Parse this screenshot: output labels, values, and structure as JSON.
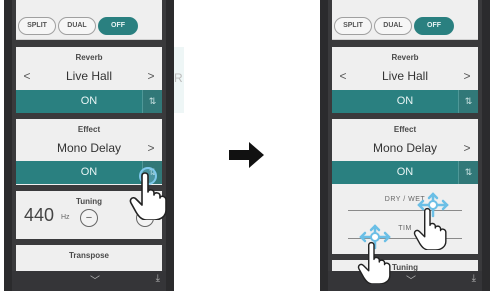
{
  "mode_buttons": [
    "SPLIT",
    "DUAL",
    "OFF"
  ],
  "reverb": {
    "title": "Reverb",
    "value": "Live Hall",
    "state": "ON"
  },
  "effect": {
    "title": "Effect",
    "value": "Mono Delay",
    "state": "ON"
  },
  "tuning": {
    "title": "Tuning",
    "value": "440",
    "unit": "Hz"
  },
  "transpose": {
    "title": "Transpose"
  },
  "effect_params": {
    "dry_wet_label": "DRY / WET",
    "time_label": "TIM"
  },
  "partial_tuning_label": "Tuning",
  "ghost_letter": "R",
  "colors": {
    "accent": "#2a8080",
    "touch": "#7ec8ec"
  },
  "icons": [
    "chevron-left-icon",
    "chevron-right-icon",
    "mixer-icon",
    "minus-icon",
    "plus-icon",
    "chevron-down-icon",
    "download-icon",
    "hand-pointer-icon",
    "arrow-right-icon"
  ]
}
